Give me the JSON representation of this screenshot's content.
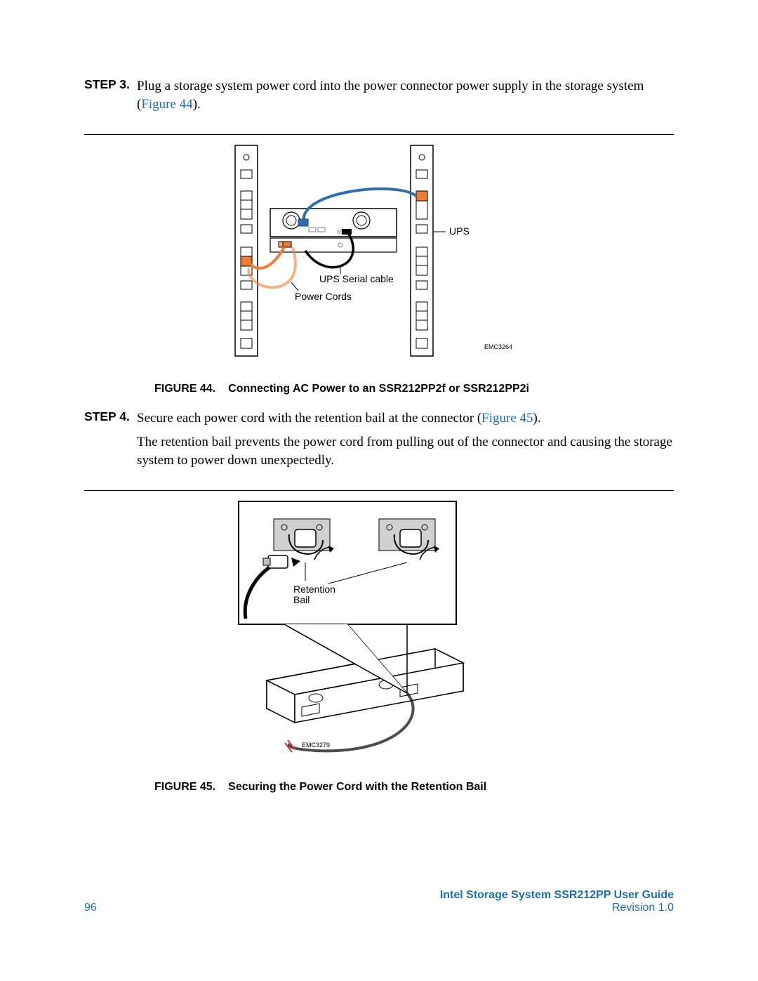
{
  "steps": {
    "s3": {
      "label": "STEP 3.",
      "text_before": "Plug a storage system power cord into the power connector power supply in the storage system (",
      "link": "Figure 44",
      "text_after": ")."
    },
    "s4": {
      "label": "STEP 4.",
      "line1_before": "Secure each power cord with the retention bail at the connector (",
      "line1_link": "Figure 45",
      "line1_after": ").",
      "line2": "The retention bail prevents the power cord from pulling out of the connector and causing the storage system to power down unexpectedly."
    }
  },
  "figure44": {
    "caption_label": "FIGURE 44.",
    "caption_text": "Connecting AC Power to an SSR212PP2f or SSR212PP2i",
    "labels": {
      "ups": "UPS",
      "serial": "UPS Serial cable",
      "power_cords": "Power Cords",
      "emc": "EMC3264"
    }
  },
  "figure45": {
    "caption_label": "FIGURE 45.",
    "caption_text": "Securing the Power Cord with the Retention Bail",
    "labels": {
      "retention": "Retention",
      "bail": "Bail",
      "emc": "EMC3279"
    }
  },
  "footer": {
    "page_no": "96",
    "guide": "Intel Storage System SSR212PP User Guide",
    "revision": "Revision 1.0"
  }
}
